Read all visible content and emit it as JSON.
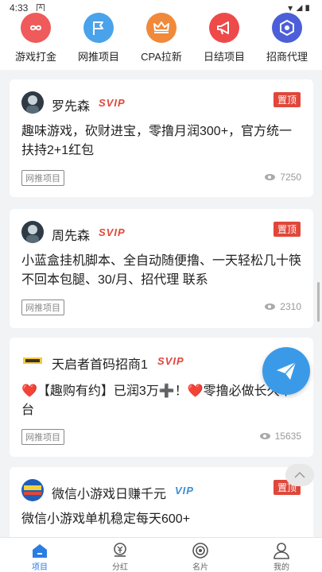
{
  "status_bar": {
    "time": "4:33",
    "sim_label": "A"
  },
  "categories": [
    {
      "label": "游戏打金",
      "icon": "infinity-icon",
      "color": "#ef5a5a",
      "glyph": "∞"
    },
    {
      "label": "网推项目",
      "icon": "flag-icon",
      "color": "#4aa3ea",
      "glyph": "⚑"
    },
    {
      "label": "CPA拉新",
      "icon": "crown-icon",
      "color": "#f0893a",
      "glyph": "♛"
    },
    {
      "label": "日结项目",
      "icon": "megaphone-icon",
      "color": "#ee4a4a",
      "glyph": "📢"
    },
    {
      "label": "招商代理",
      "icon": "hexagon-share-icon",
      "color": "#4c5fd8",
      "glyph": "⬡"
    }
  ],
  "posts": [
    {
      "author": "罗先森",
      "badge": "SVIP",
      "badge_color": "#e0473a",
      "pinned_label": "置顶",
      "content": "趣味游戏，砍财进宝，零撸月润300+，官方统一扶持2+1红包",
      "tag": "网推项目",
      "views": "7250"
    },
    {
      "author": "周先森",
      "badge": "SVIP",
      "badge_color": "#e0473a",
      "pinned_label": "置顶",
      "content": "小蓝盒挂机脚本、全自动随便撸、一天轻松几十筷不回本包腿、30/月、招代理 联系",
      "tag": "网推项目",
      "views": "2310"
    },
    {
      "author": "天启者首码招商1",
      "badge": "SVIP",
      "badge_color": "#e0473a",
      "pinned_label": "",
      "content": "❤️【趣购有约】已润3万➕！❤️零撸必做长久平台",
      "tag": "网推项目",
      "views": "15635"
    },
    {
      "author": "微信小游戏日赚千元",
      "badge": "VIP",
      "badge_color": "#3a8fd8",
      "pinned_label": "置顶",
      "content": "微信小游戏单机稳定每天600+",
      "tag": "",
      "views": ""
    }
  ],
  "tabbar": [
    {
      "label": "项目",
      "icon": "home-icon",
      "active": true
    },
    {
      "label": "分红",
      "icon": "yuan-coin-icon",
      "active": false
    },
    {
      "label": "名片",
      "icon": "target-icon",
      "active": false
    },
    {
      "label": "我的",
      "icon": "user-icon",
      "active": false
    }
  ]
}
